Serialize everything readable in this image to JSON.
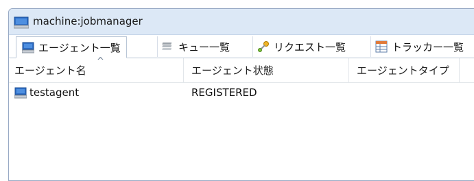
{
  "window": {
    "title": "machine:jobmanager",
    "icon": "computer-monitor-icon"
  },
  "tabs": [
    {
      "label": "エージェント一覧",
      "icon": "agent-monitor-icon",
      "active": true
    },
    {
      "label": "キュー一覧",
      "icon": "queue-stack-icon",
      "active": false
    },
    {
      "label": "リクエスト一覧",
      "icon": "request-key-icon",
      "active": false
    },
    {
      "label": "トラッカー一覧",
      "icon": "tracker-grid-icon",
      "active": false
    }
  ],
  "table": {
    "columns": [
      "エージェント名",
      "エージェント状態",
      "エージェントタイプ"
    ],
    "sort_indicator": "^",
    "rows": [
      {
        "name": "testagent",
        "state": "REGISTERED",
        "type": "",
        "icon": "agent-monitor-icon"
      }
    ]
  },
  "colors": {
    "title_bar": "#dce8f6",
    "window_border": "#97a9c4",
    "monitor_icon_blue": "#2f6fc7"
  }
}
